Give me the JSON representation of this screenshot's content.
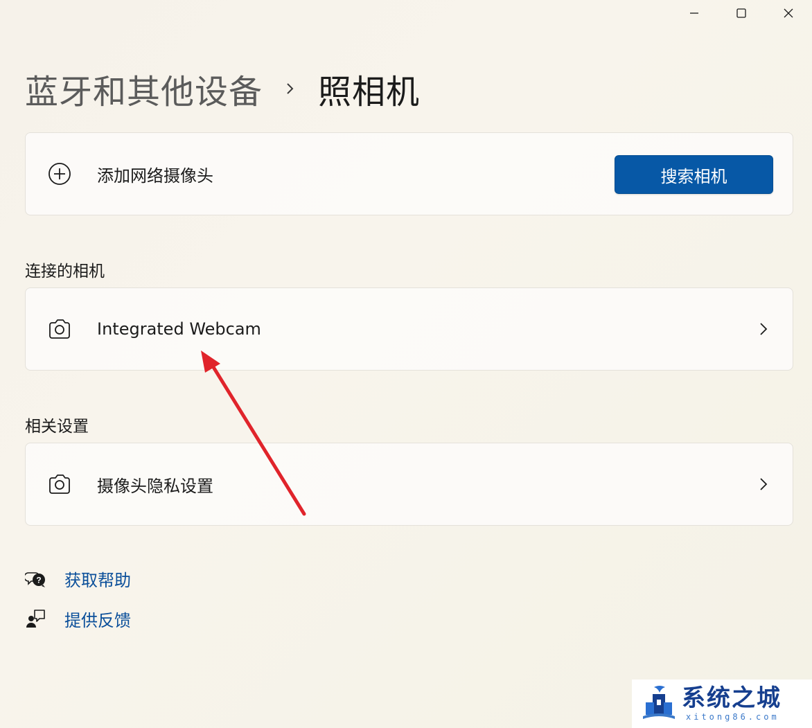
{
  "window": {
    "controls": [
      "minimize",
      "maximize",
      "close"
    ]
  },
  "breadcrumb": {
    "parent": "蓝牙和其他设备",
    "separator_icon": "chevron-right-icon",
    "current": "照相机"
  },
  "add_camera_card": {
    "icon": "add-circle-icon",
    "label": "添加网络摄像头",
    "button_label": "搜索相机"
  },
  "connected_section": {
    "title": "连接的相机",
    "items": [
      {
        "icon": "camera-icon",
        "label": "Integrated Webcam"
      }
    ]
  },
  "related_section": {
    "title": "相关设置",
    "items": [
      {
        "icon": "camera-icon",
        "label": "摄像头隐私设置"
      }
    ]
  },
  "links": {
    "help": {
      "icon": "help-chat-icon",
      "label": "获取帮助"
    },
    "feedback": {
      "icon": "feedback-icon",
      "label": "提供反馈"
    }
  },
  "annotation": {
    "type": "red-arrow",
    "color": "#e0242b",
    "target": "Integrated Webcam"
  },
  "watermark": {
    "title": "系统之城",
    "subtitle": "xitong86.com"
  },
  "colors": {
    "accent_button": "#0758a6",
    "link": "#0b4f9a"
  }
}
